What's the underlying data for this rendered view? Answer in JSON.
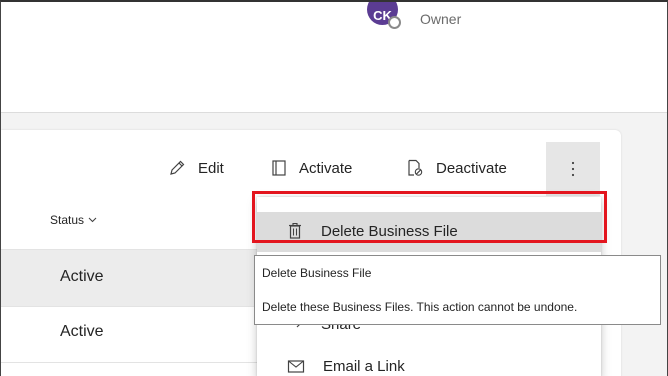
{
  "header": {
    "avatar_initials": "CK",
    "role": "Owner",
    "avatar_color": "#5b3c93"
  },
  "command_bar": {
    "edit_label": "Edit",
    "activate_label": "Activate",
    "deactivate_label": "Deactivate",
    "more_icon": "more-vertical-icon"
  },
  "table": {
    "status_header": "Status",
    "rows": [
      {
        "status": "Active"
      },
      {
        "status": "Active"
      }
    ]
  },
  "overflow_menu": {
    "items": [
      {
        "label": "Delete Business File",
        "icon": "trash-icon"
      },
      {
        "label": "Share",
        "icon": "share-icon"
      },
      {
        "label": "Email a Link",
        "icon": "email-link-icon"
      }
    ]
  },
  "tooltip": {
    "title": "Delete Business File",
    "description": "Delete these Business Files. This action cannot be undone."
  },
  "colors": {
    "highlight": "#e3151e",
    "hover_bg": "#dcdcdc",
    "row_selected_bg": "#ececec"
  }
}
